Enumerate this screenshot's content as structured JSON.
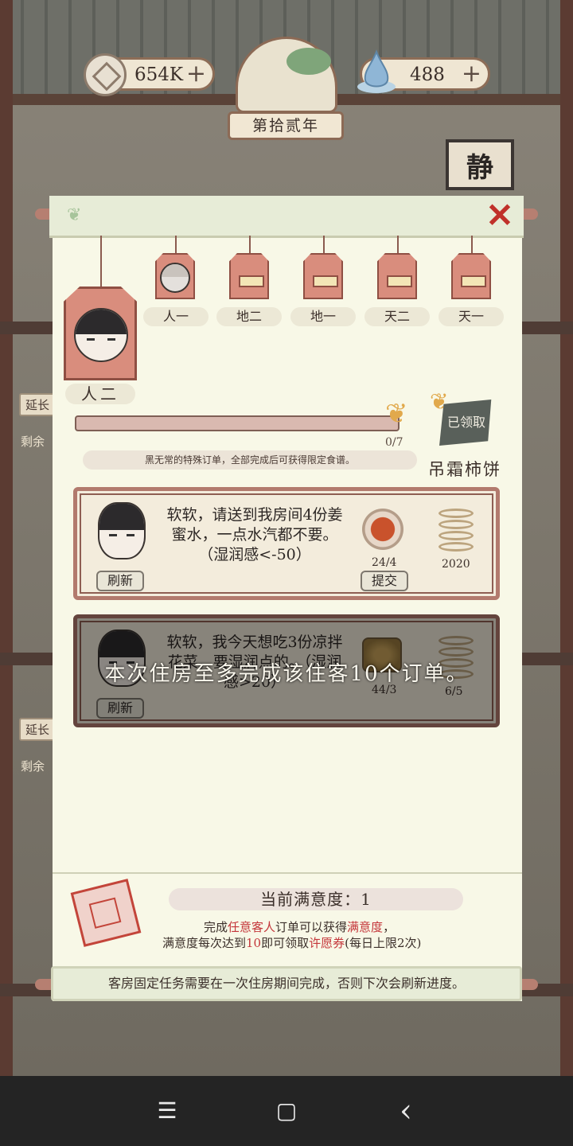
{
  "topbar": {
    "coins": "654K",
    "water": "488",
    "year": "第拾贰年"
  },
  "scene": {
    "static_sign": "静",
    "extend_label": "延长",
    "remaining_label": "剩余"
  },
  "guest_tags": {
    "current": "人二",
    "items": [
      "人一",
      "地二",
      "地一",
      "天二",
      "天一"
    ]
  },
  "progress": {
    "value": 0,
    "max": 7,
    "count_text": "0/7",
    "claimed_label": "已领取",
    "info": "黑无常的特殊订单，全部完成后可获得限定食谱。",
    "reward_name": "吊霜柿饼"
  },
  "orders": [
    {
      "text": "软软，请送到我房间4份姜蜜水，一点水汽都不要。（湿润感<-50）",
      "refresh_label": "刷新",
      "item_count": "24/4",
      "submit_label": "提交",
      "reward": "2020"
    },
    {
      "text": "软软，我今天想吃3份凉拌花菜，要湿润点的。（湿润感>20）",
      "refresh_label": "刷新",
      "item_count": "44/3",
      "reward": "6/5"
    }
  ],
  "overlay_message": "本次住房至多完成该住客10个订单。",
  "satisfaction": {
    "title": "当前满意度：1",
    "line1_a": "完成",
    "line1_hl1": "任意客人",
    "line1_b": "订单可以获得",
    "line1_hl2": "满意度",
    "line1_c": "，",
    "line2_a": "满意度每次达到",
    "line2_hl1": "10",
    "line2_b": "即可领取",
    "line2_hl2": "许愿券",
    "line2_c": "(每日上限2次)"
  },
  "footer_note": "客房固定任务需要在一次住房期间完成，否则下次会刷新进度。",
  "system_nav": {
    "menu_icon": "☰",
    "home_icon": "▢",
    "back_icon": "‹"
  }
}
